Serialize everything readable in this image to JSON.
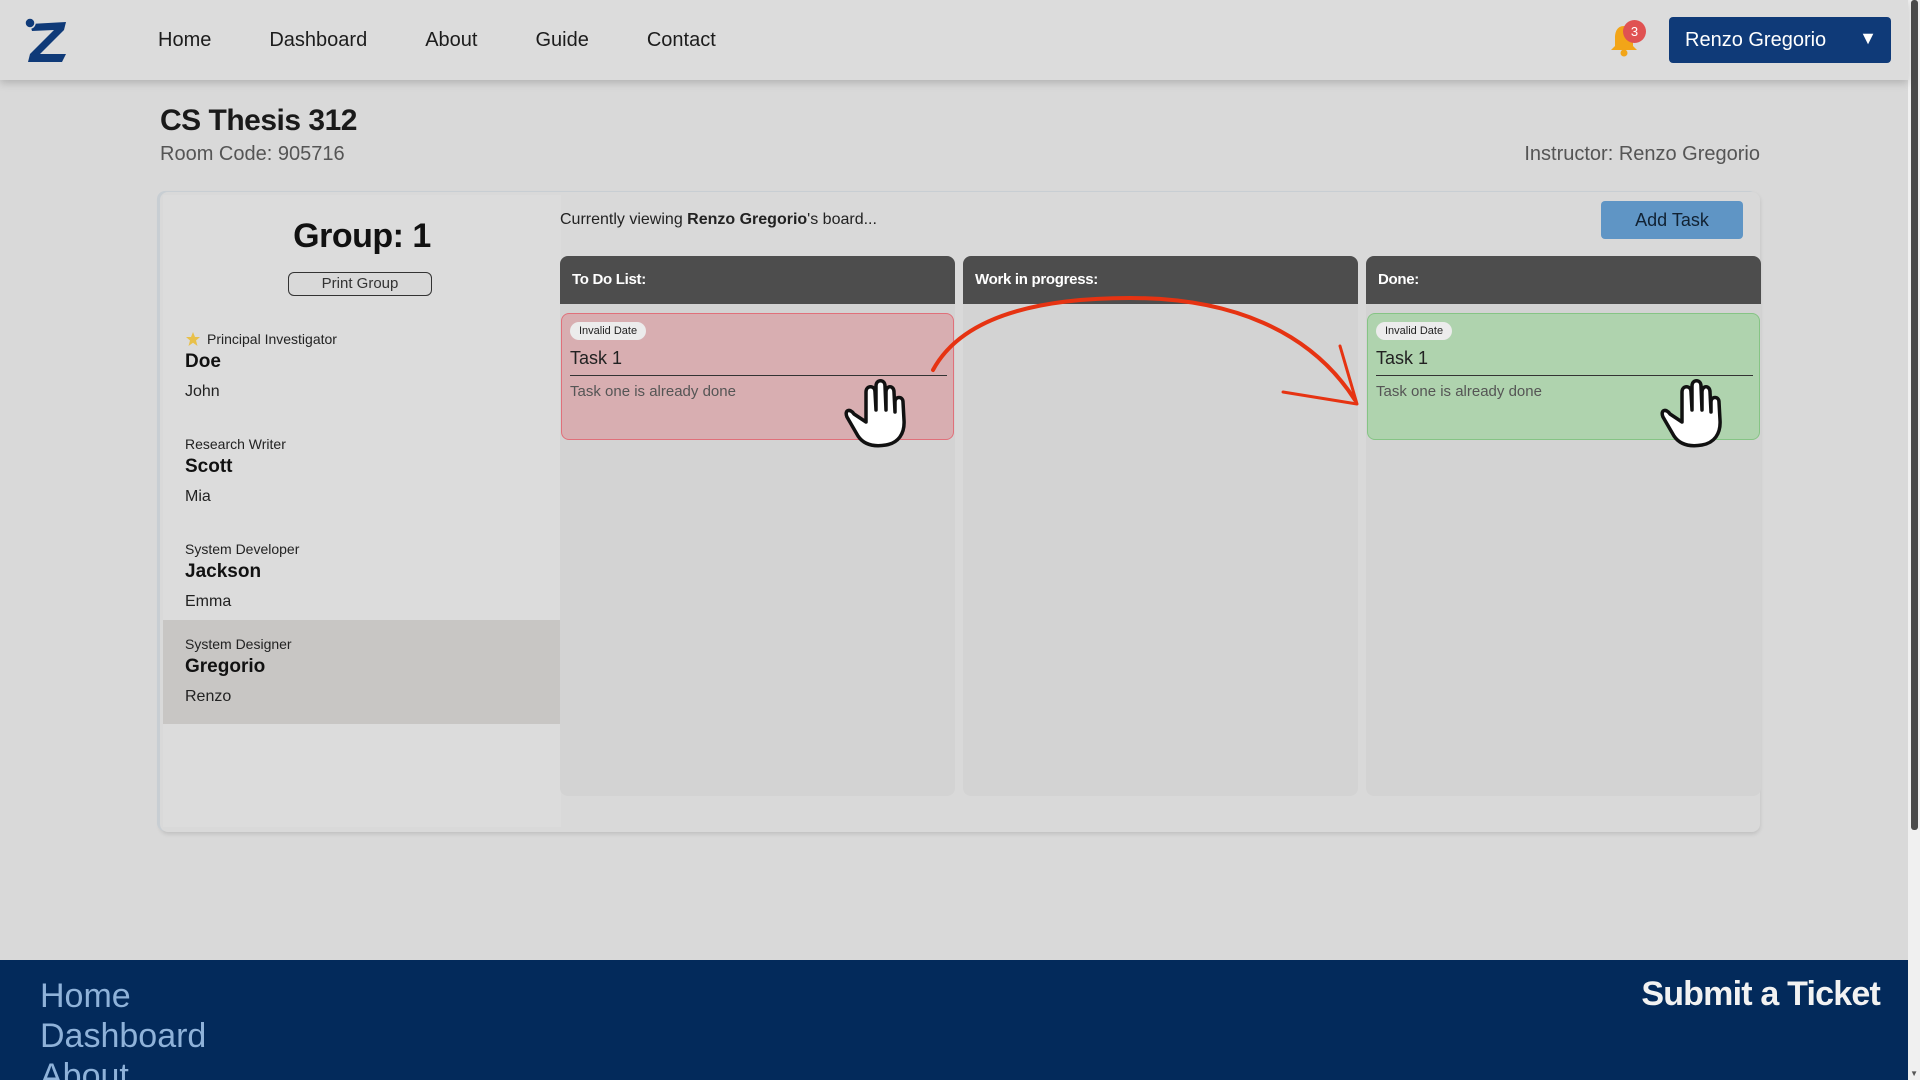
{
  "nav": {
    "links": [
      "Home",
      "Dashboard",
      "About",
      "Guide",
      "Contact"
    ],
    "notification_count": "3",
    "user_name": "Renzo Gregorio",
    "caret": "▼"
  },
  "header": {
    "class_title": "CS Thesis 312",
    "room_code": "Room Code: 905716",
    "instructor": "Instructor: Renzo Gregorio"
  },
  "group": {
    "title": "Group: 1",
    "print_label": "Print Group",
    "members": [
      {
        "role": "Principal Investigator",
        "last": "Doe",
        "first": "John",
        "leader": true
      },
      {
        "role": "Research Writer",
        "last": "Scott",
        "first": "Mia"
      },
      {
        "role": "System Developer",
        "last": "Jackson",
        "first": "Emma"
      },
      {
        "role": "System Designer",
        "last": "Gregorio",
        "first": "Renzo",
        "active": true
      }
    ]
  },
  "board": {
    "viewing_prefix": "Currently viewing ",
    "viewing_name": "Renzo Gregorio",
    "viewing_suffix": "'s board...",
    "add_task_label": "Add Task",
    "columns": [
      {
        "title": "To Do List:"
      },
      {
        "title": "Work in progress:"
      },
      {
        "title": "Done:"
      }
    ],
    "todo_card": {
      "badge": "Invalid Date",
      "title": "Task 1",
      "desc": "Task one is already done",
      "color": "#d8aeb1"
    },
    "done_card": {
      "badge": "Invalid Date",
      "title": "Task 1",
      "desc": "Task one is already done",
      "color": "#afd3ae"
    }
  },
  "footer": {
    "links": [
      "Home",
      "Dashboard",
      "About"
    ],
    "ticket_label": "Submit a Ticket"
  },
  "colors": {
    "brand": "#0f3a78",
    "footer": "#032a5b",
    "annotation_arrow": "#e63312"
  }
}
